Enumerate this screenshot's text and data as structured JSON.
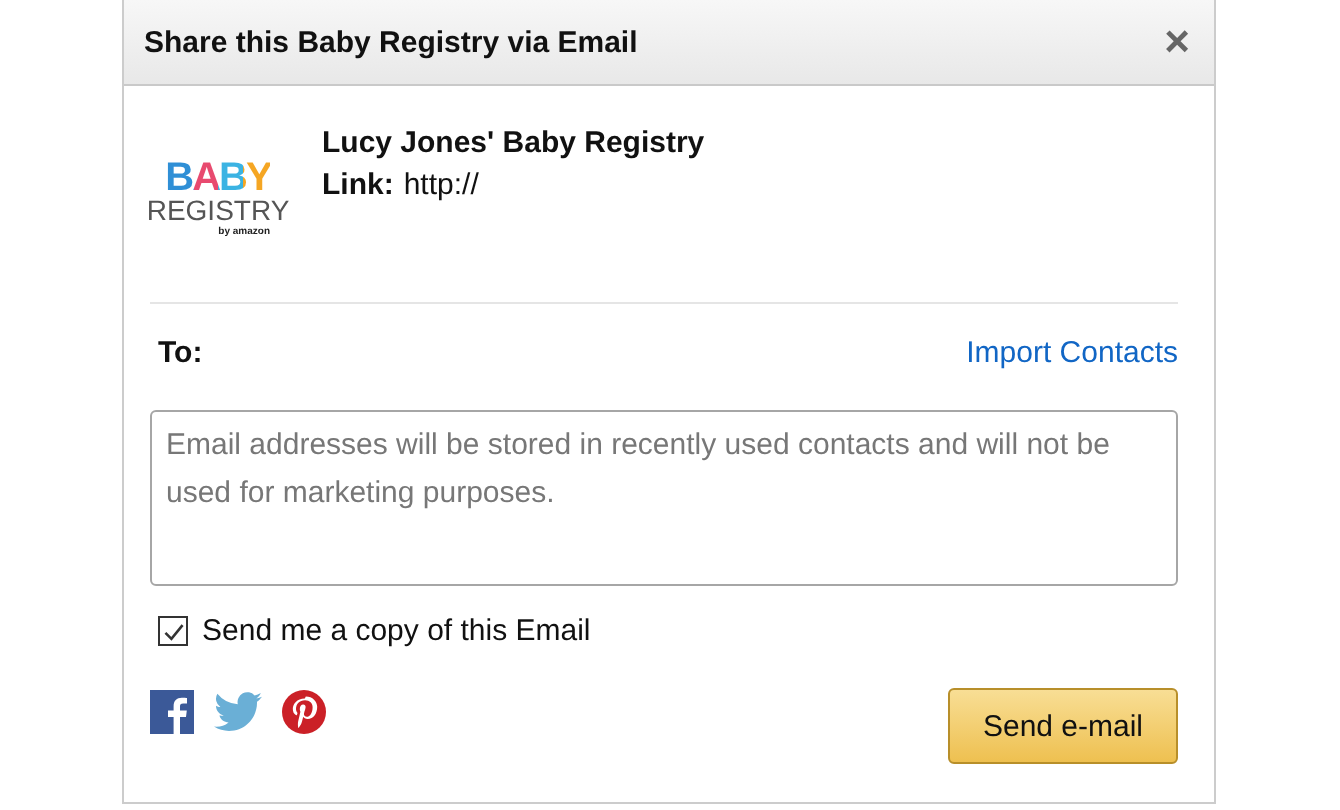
{
  "dialog": {
    "title": "Share this Baby Registry via Email",
    "close": "×"
  },
  "registry": {
    "logo": {
      "top": "BABY",
      "bottom": "REGISTRY",
      "byline": "by amazon"
    },
    "name": "Lucy Jones' Baby Registry",
    "link_label": "Link:",
    "link": "http://"
  },
  "to": {
    "label": "To:",
    "import": "Import Contacts",
    "placeholder": "Email addresses will be stored in recently used contacts and will not be used for marketing purposes."
  },
  "copy": {
    "label": "Send me a copy of this Email",
    "checked": true
  },
  "social": [
    {
      "kind": "facebook"
    },
    {
      "kind": "twitter"
    },
    {
      "kind": "pinterest"
    }
  ],
  "send": "Send e-mail"
}
